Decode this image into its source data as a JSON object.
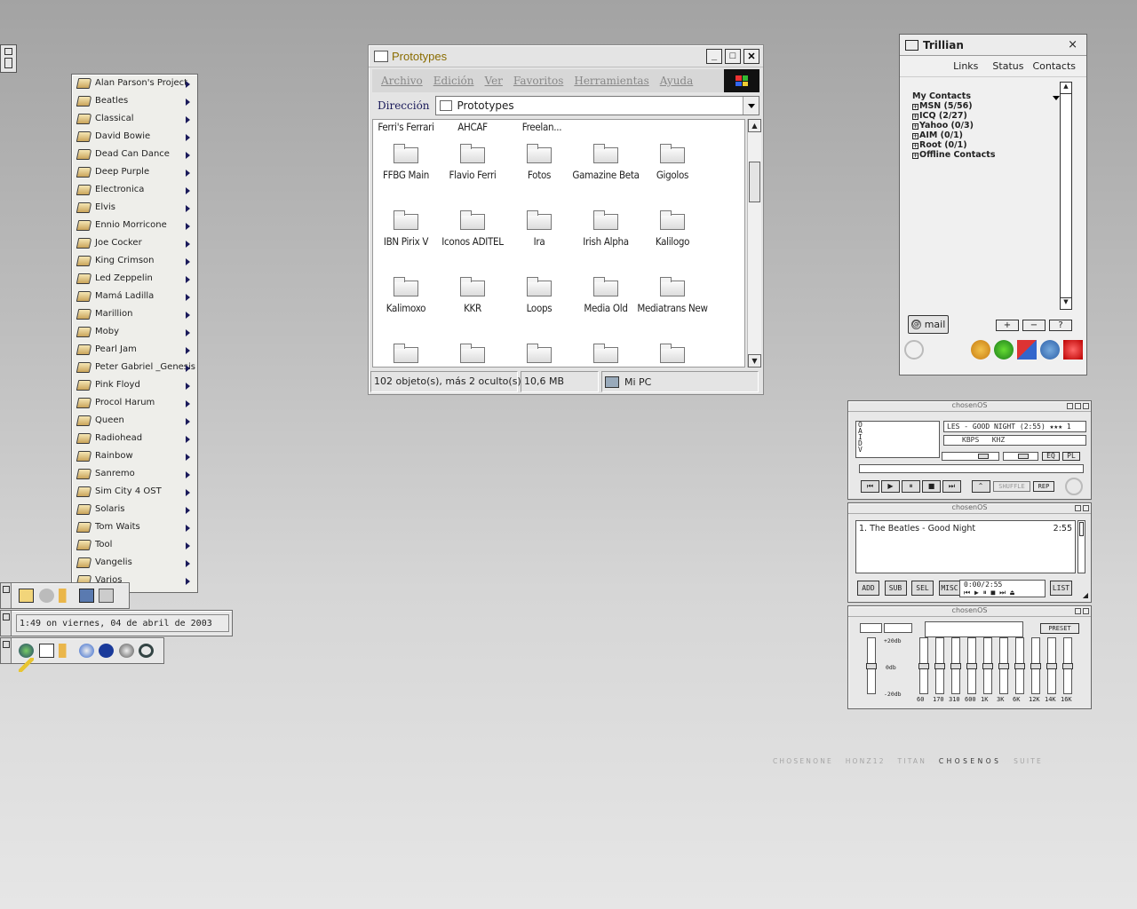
{
  "artist_menu": {
    "items": [
      "Alan Parson's Project",
      "Beatles",
      "Classical",
      "David Bowie",
      "Dead Can Dance",
      "Deep Purple",
      "Electronica",
      "Elvis",
      "Ennio Morricone",
      "Joe Cocker",
      "King Crimson",
      "Led Zeppelin",
      "Mamá Ladilla",
      "Marillion",
      "Moby",
      "Pearl Jam",
      "Peter Gabriel _Genesis",
      "Pink Floyd",
      "Procol Harum",
      "Queen",
      "Radiohead",
      "Rainbow",
      "Sanremo",
      "Sim City 4 OST",
      "Solaris",
      "Tom Waits",
      "Tool",
      "Vangelis",
      "Varios"
    ]
  },
  "explorer": {
    "title": "Prototypes",
    "menu": [
      "Archivo",
      "Edición",
      "Ver",
      "Favoritos",
      "Herramientas",
      "Ayuda"
    ],
    "address_label": "Dirección",
    "address_value": "Prototypes",
    "partial_row": [
      "Ferri's Ferrari",
      "AHCAF",
      "Freelan..."
    ],
    "folders": [
      "FFBG Main",
      "Flavio Ferri",
      "Fotos",
      "Gamazine Beta",
      "Gigolos",
      "IBN Pirix V",
      "Iconos ADITEL",
      "Ira",
      "Irish Alpha",
      "Kalilogo",
      "Kalimoxo",
      "KKR",
      "Loops",
      "Media Old",
      "Mediatrans New",
      "",
      "",
      "",
      "",
      ""
    ],
    "status_count": "102 objeto(s), más 2 oculto(s)",
    "status_size": "10,6 MB",
    "status_location": "Mi PC",
    "close_glyph": "✕",
    "max_glyph": "□",
    "min_glyph": "_"
  },
  "trillian": {
    "title": "Trillian",
    "close": "×",
    "tabs": [
      "Links",
      "Status",
      "Contacts"
    ],
    "contacts_header": "My Contacts",
    "groups": [
      "MSN (5/56)",
      "ICQ (2/27)",
      "Yahoo (0/3)",
      "AIM (0/1)",
      "Root (0/1)",
      "Offline Contacts"
    ],
    "mail_label": "mail",
    "ctrl_buttons": [
      "+",
      "−",
      "?"
    ]
  },
  "player": {
    "title": "chosenOS",
    "song_display": "LES - GOOD NIGHT (2:55)  ★★★  1",
    "kbps": "KBPS",
    "khz": "KHZ",
    "eq_btn": "EQ",
    "pl_btn": "PL",
    "shuffle": "SHUFFLE",
    "rep": "REP",
    "vis_letters": "OAIDV"
  },
  "playlist": {
    "title": "chosenOS",
    "track": "1. The Beatles - Good Night",
    "track_time": "2:55",
    "buttons": [
      "ADD",
      "SUB",
      "SEL",
      "MISC",
      "LIST"
    ],
    "time_readout": "0:00/2:55"
  },
  "equalizer": {
    "title": "chosenOS",
    "preset": "PRESET",
    "scale": [
      "+20db",
      "0db",
      "-20db"
    ],
    "bands": [
      "60",
      "170",
      "310",
      "600",
      "1K",
      "3K",
      "6K",
      "12K",
      "14K",
      "16K"
    ],
    "levels": [
      0,
      0,
      0,
      0,
      0,
      0,
      0,
      0,
      0,
      0
    ]
  },
  "taskbar": {
    "clock": "1:49  on viernes, 04 de abril de 2003"
  },
  "signature": {
    "parts": [
      "CHOSENONE",
      "HONZ12",
      "TITAN",
      "CHOSENOS",
      "SUITE"
    ]
  },
  "colors": {
    "title_text": "#8a6c00",
    "accent_link": "#1a1a5a"
  }
}
